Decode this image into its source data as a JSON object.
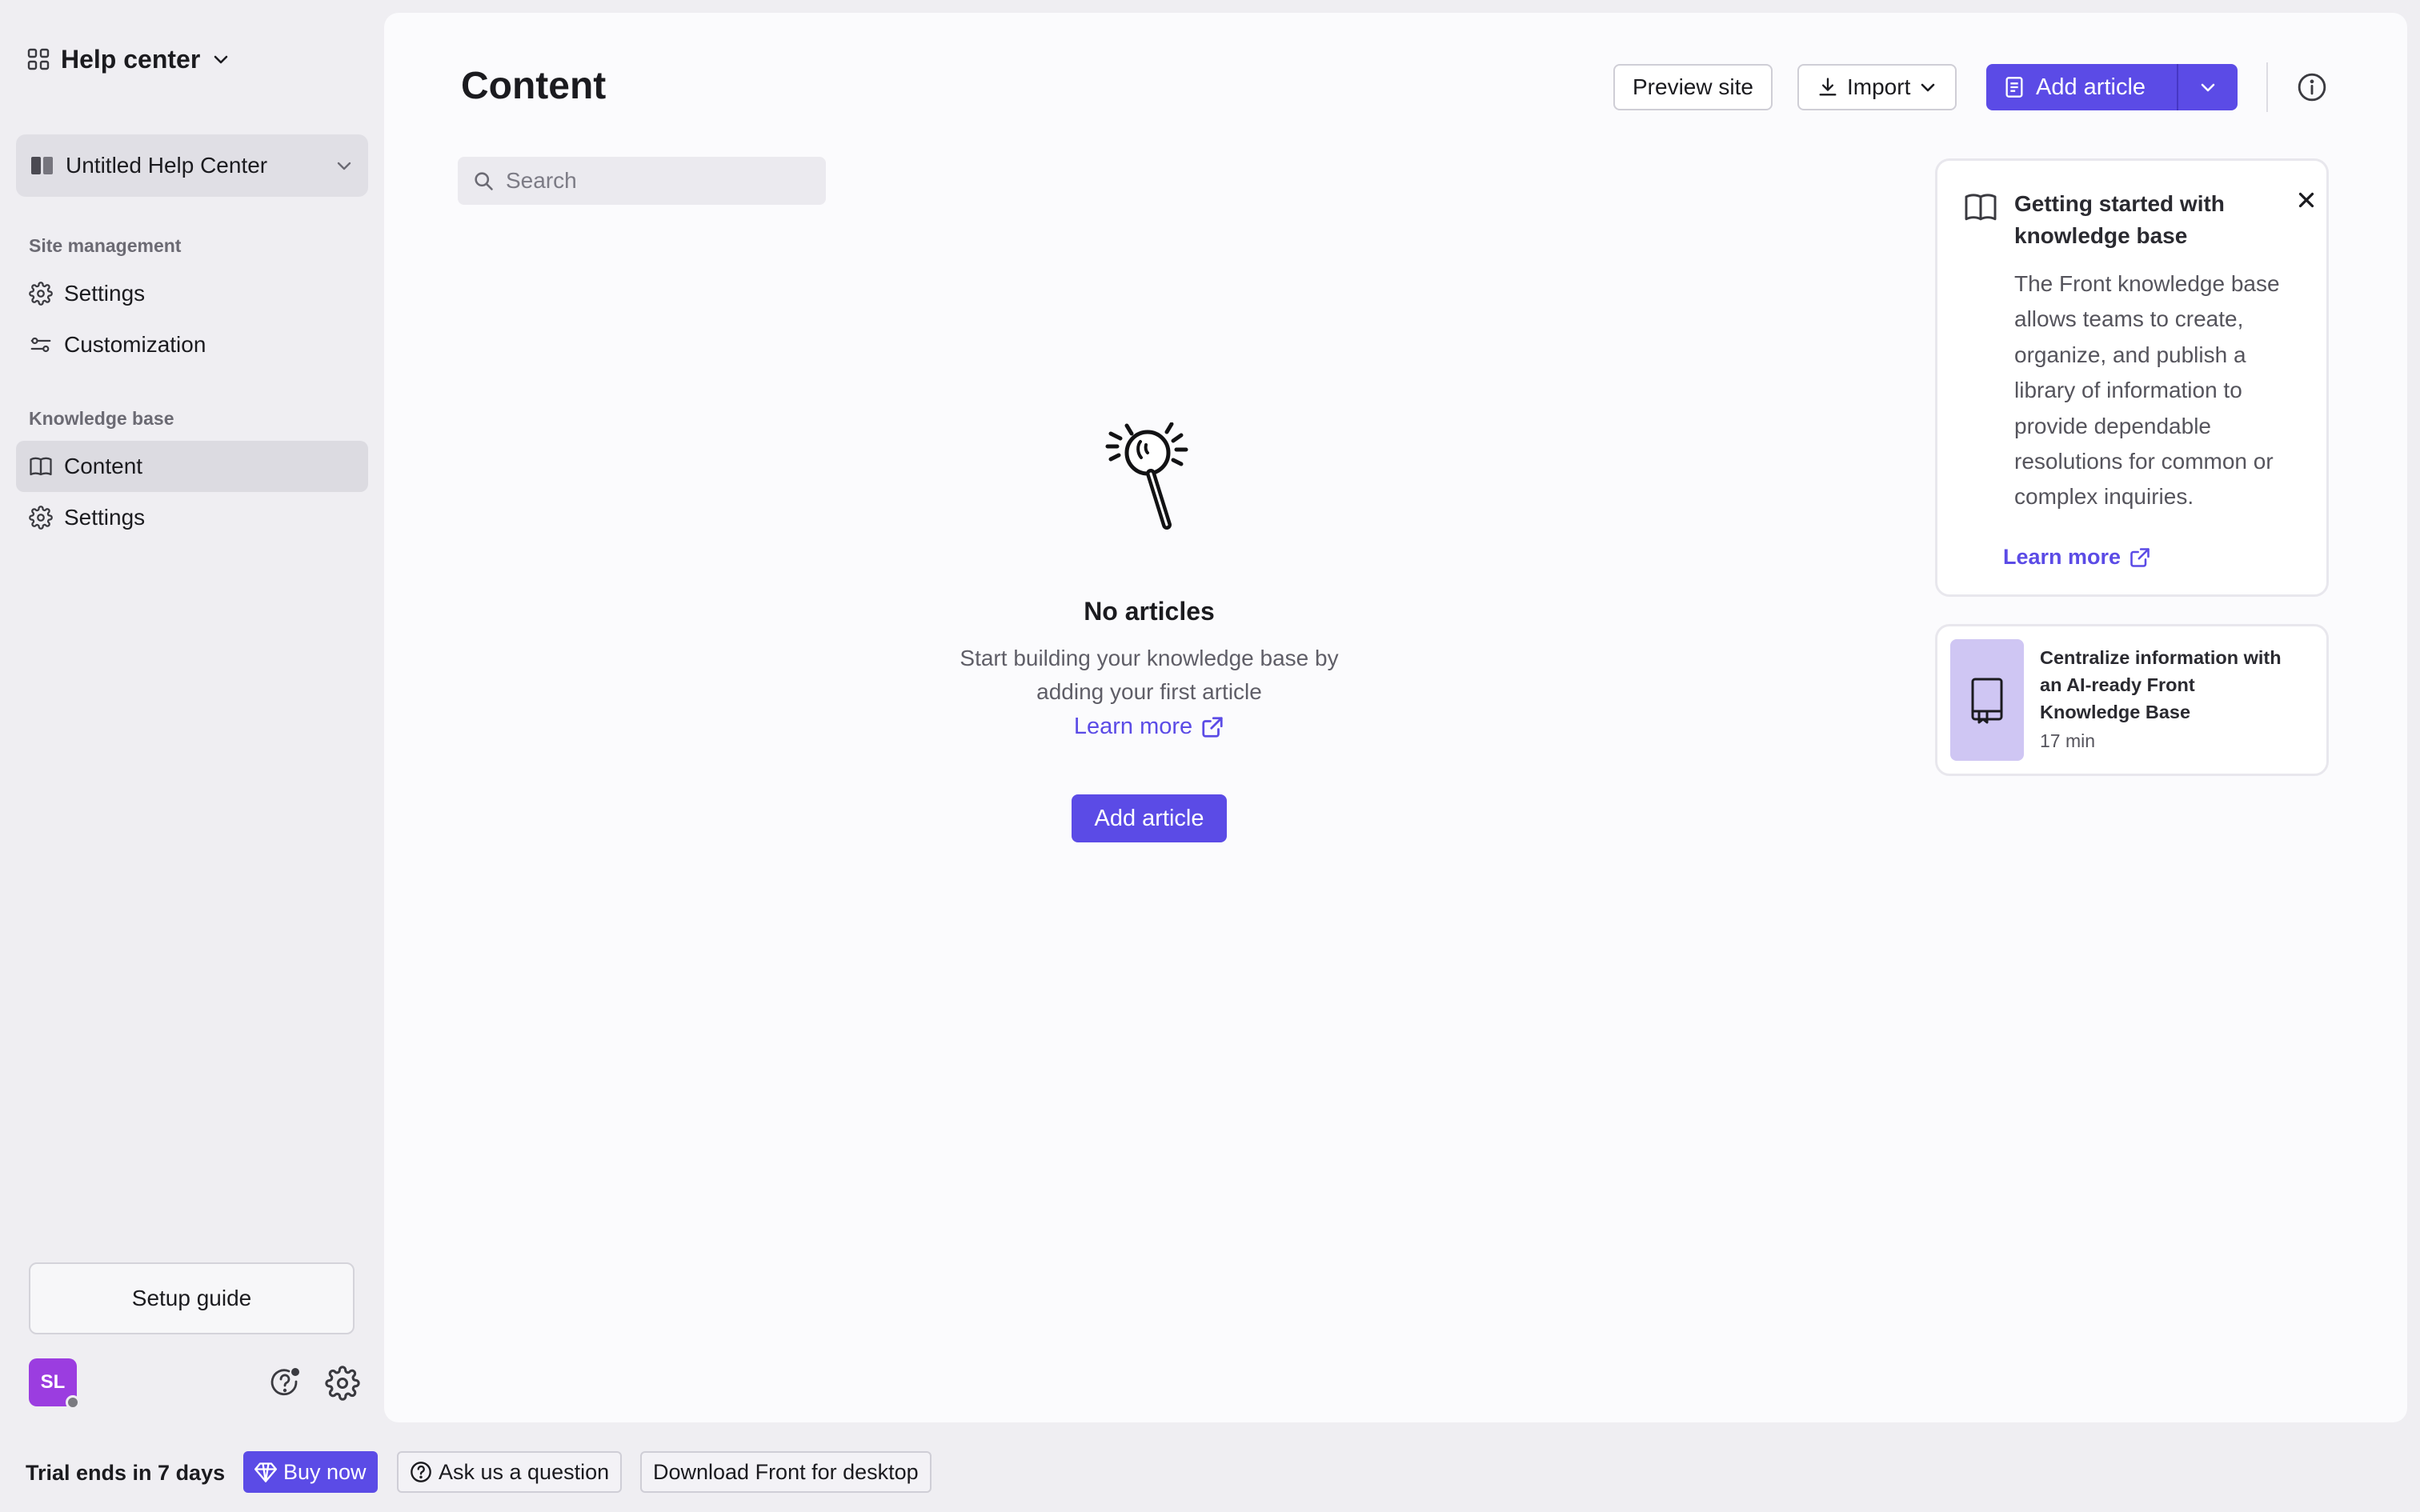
{
  "colors": {
    "accent": "#5b4be6",
    "avatar": "#9b3de0",
    "active_nav": "#dcdbe1"
  },
  "app_switcher": {
    "title": "Help center",
    "icon": "grid-icon"
  },
  "site_select": {
    "label": "Untitled Help Center",
    "icon": "book-split-icon"
  },
  "sidebar": {
    "site_management": {
      "heading": "Site management",
      "items": [
        {
          "label": "Settings",
          "icon": "gear-icon"
        },
        {
          "label": "Customization",
          "icon": "sliders-icon"
        }
      ]
    },
    "knowledge_base": {
      "heading": "Knowledge base",
      "items": [
        {
          "label": "Content",
          "icon": "book-icon",
          "active": true
        },
        {
          "label": "Settings",
          "icon": "gear-icon"
        }
      ]
    },
    "setup_guide": "Setup guide",
    "avatar_initials": "SL"
  },
  "main": {
    "title": "Content",
    "preview_label": "Preview site",
    "import_label": "Import",
    "add_article_label": "Add article",
    "search_placeholder": "Search",
    "empty": {
      "title": "No articles",
      "description": "Start building your knowledge base by adding your first article",
      "learn_more": "Learn more",
      "add_label": "Add article"
    },
    "getting_started": {
      "title": "Getting started with knowledge base",
      "body": "The Front knowledge base allows teams to create, organize, and publish a library of information to provide dependable resolutions for common or complex inquiries.",
      "learn_more": "Learn more"
    },
    "video_card": {
      "title": "Centralize information with an AI-ready Front Knowledge Base",
      "duration": "17 min"
    }
  },
  "bottom_bar": {
    "trial": "Trial ends in 7 days",
    "buy_now": "Buy now",
    "ask": "Ask us a question",
    "download": "Download Front for desktop"
  }
}
